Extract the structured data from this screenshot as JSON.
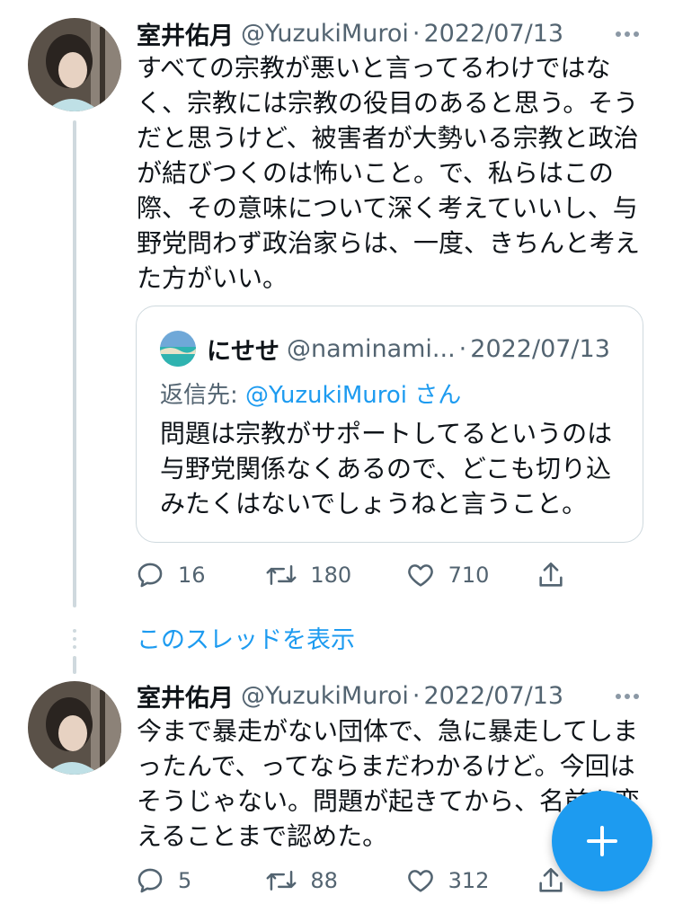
{
  "tweets": [
    {
      "name": "室井佑月",
      "handle": "@YuzukiMuroi",
      "separator": "·",
      "date": "2022/07/13",
      "lines": [
        "すべての宗教が悪いと言ってるわけではな",
        "く、宗教には宗教の役目のあると思う。そう",
        "だと思うけど、被害者が大勢いる宗教と政治",
        "が結びつくのは怖いこと。で、私らはこの",
        "際、その意味について深く考えていいし、与",
        "野党問わず政治家らは、一度、きちんと考え",
        "た方がいい。"
      ],
      "quote": {
        "name": "にせせ",
        "handle": "@naminami...",
        "separator": "·",
        "date": "2022/07/13",
        "reply_prefix": "返信先: ",
        "reply_mention": "@YuzukiMuroi",
        "reply_suffix": " さん",
        "lines": [
          "問題は宗教がサポートしてるというのは",
          "与野党関係なくあるので、どこも切り込",
          "みたくはないでしょうねと言うこと。"
        ]
      },
      "replies": "16",
      "retweets": "180",
      "likes": "710"
    },
    {
      "name": "室井佑月",
      "handle": "@YuzukiMuroi",
      "separator": "·",
      "date": "2022/07/13",
      "lines": [
        "今まで暴走がない団体で、急に暴走してしま",
        "ったんで、ってならまだわかるけど。今回は",
        "そうじゃない。問題が起きてから、名前を変",
        "えることまで認めた。"
      ],
      "replies": "5",
      "retweets": "88",
      "likes": "312"
    }
  ],
  "show_thread": "このスレッドを表示",
  "icons": {
    "reply": "reply-icon",
    "retweet": "retweet-icon",
    "like": "heart-icon",
    "share": "share-icon",
    "more": "more-icon",
    "compose": "plus-icon"
  },
  "colors": {
    "accent": "#1d9bf0",
    "secondary_text": "#536471",
    "border": "#cfd9de"
  }
}
